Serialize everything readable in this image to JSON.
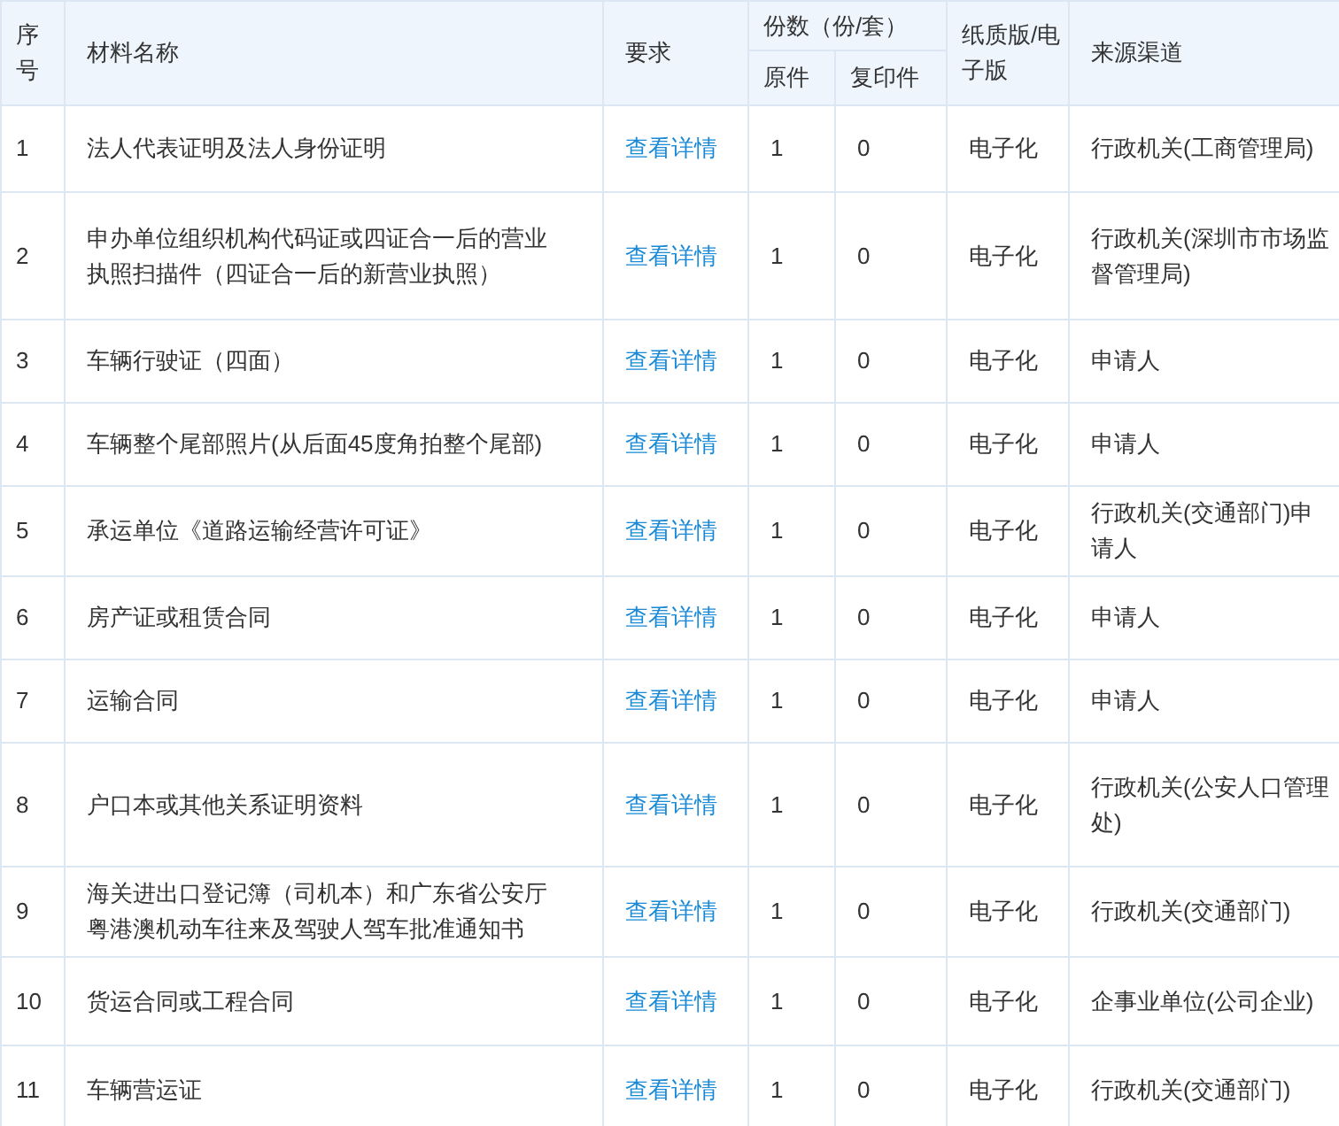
{
  "table": {
    "columns": [
      {
        "label": "序号"
      },
      {
        "label": "材料名称"
      },
      {
        "label": "要求"
      },
      {
        "label": "份数（份/套）",
        "sub": [
          "原件",
          "复印件"
        ]
      },
      {
        "label": "纸质版/电子版"
      },
      {
        "label": "来源渠道"
      }
    ],
    "rows": [
      {
        "no": "1",
        "name": "法人代表证明及法人身份证明",
        "requirement": "查看详情",
        "original": "1",
        "copy": "0",
        "format": "电子化",
        "source": "行政机关(工商管理局)"
      },
      {
        "no": "2",
        "name": "申办单位组织机构代码证或四证合一后的营业执照扫描件（四证合一后的新营业执照）",
        "requirement": "查看详情",
        "original": "1",
        "copy": "0",
        "format": "电子化",
        "source": "行政机关(深圳市市场监督管理局)"
      },
      {
        "no": "3",
        "name": "车辆行驶证（四面）",
        "requirement": "查看详情",
        "original": "1",
        "copy": "0",
        "format": "电子化",
        "source": "申请人"
      },
      {
        "no": "4",
        "name": "车辆整个尾部照片(从后面45度角拍整个尾部)",
        "requirement": "查看详情",
        "original": "1",
        "copy": "0",
        "format": "电子化",
        "source": "申请人"
      },
      {
        "no": "5",
        "name": "承运单位《道路运输经营许可证》",
        "requirement": "查看详情",
        "original": "1",
        "copy": "0",
        "format": "电子化",
        "source": "行政机关(交通部门)申请人"
      },
      {
        "no": "6",
        "name": "房产证或租赁合同",
        "requirement": "查看详情",
        "original": "1",
        "copy": "0",
        "format": "电子化",
        "source": "申请人"
      },
      {
        "no": "7",
        "name": "运输合同",
        "requirement": "查看详情",
        "original": "1",
        "copy": "0",
        "format": "电子化",
        "source": "申请人"
      },
      {
        "no": "8",
        "name": "户口本或其他关系证明资料",
        "requirement": "查看详情",
        "original": "1",
        "copy": "0",
        "format": "电子化",
        "source": "行政机关(公安人口管理处)"
      },
      {
        "no": "9",
        "name": "海关进出口登记簿（司机本）和广东省公安厅粤港澳机动车往来及驾驶人驾车批准通知书",
        "requirement": "查看详情",
        "original": "1",
        "copy": "0",
        "format": "电子化",
        "source": "行政机关(交通部门)"
      },
      {
        "no": "10",
        "name": "货运合同或工程合同",
        "requirement": "查看详情",
        "original": "1",
        "copy": "0",
        "format": "电子化",
        "source": "企事业单位(公司企业)"
      },
      {
        "no": "11",
        "name": "车辆营运证",
        "requirement": "查看详情",
        "original": "1",
        "copy": "0",
        "format": "电子化",
        "source": "行政机关(交通部门)"
      }
    ]
  }
}
